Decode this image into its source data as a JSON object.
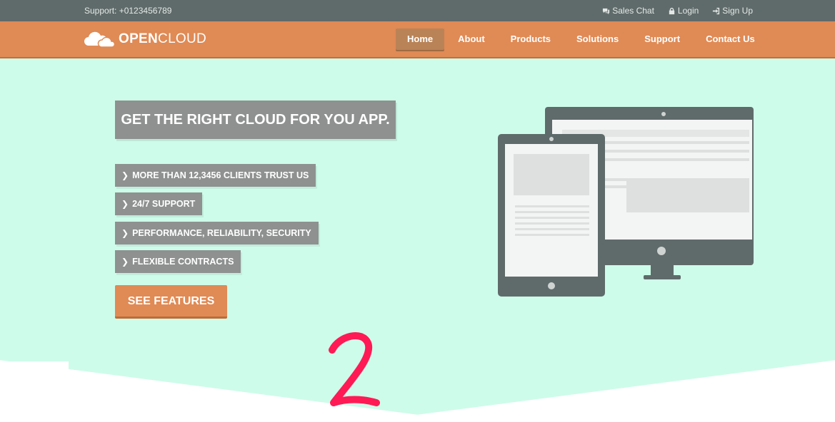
{
  "topbar": {
    "support": "Support: +0123456789",
    "links": [
      {
        "label": "Sales Chat",
        "icon": "chat-icon"
      },
      {
        "label": "Login",
        "icon": "lock-icon"
      },
      {
        "label": "Sign Up",
        "icon": "sign-in-icon"
      }
    ]
  },
  "brand": {
    "bold": "OPEN",
    "light": "CLOUD",
    "icon": "cloud-icon"
  },
  "nav": {
    "items": [
      "Home",
      "About",
      "Products",
      "Solutions",
      "Support",
      "Contact Us"
    ],
    "active": "Home"
  },
  "hero": {
    "headline": "GET THE RIGHT CLOUD FOR YOU APP.",
    "features": [
      "MORE THAN 12,3456 CLIENTS TRUST US",
      "24/7 SUPPORT",
      "PERFORMANCE, RELIABILITY, SECURITY",
      "FLEXIBLE CONTRACTS"
    ],
    "cta": "SEE FEATURES",
    "illustration": "tablet-and-monitor-illustration"
  },
  "annotation": {
    "text": "2",
    "color": "#ff1a55"
  },
  "colors": {
    "topbar": "#5f6b6a",
    "navbar": "#e08a55",
    "hero": "#cefcea",
    "label_box": "#8e9190"
  }
}
